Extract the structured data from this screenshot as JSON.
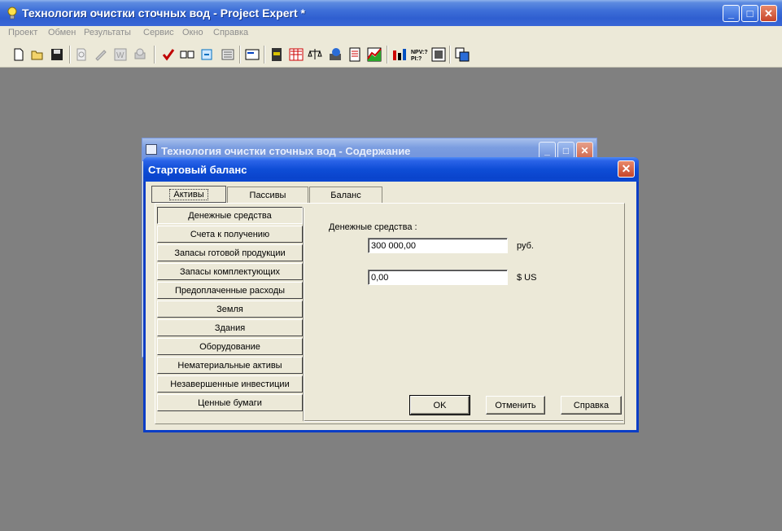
{
  "app": {
    "title": "Технология очистки сточных вод - Project Expert *",
    "minimize": "_",
    "maximize": "□",
    "close": "✕"
  },
  "menu": [
    "Проект",
    "Обмен",
    "Результаты",
    "Сервис",
    "Окно",
    "Справка"
  ],
  "toolbar_icons": [
    "new-icon",
    "open-icon",
    "save-icon",
    "preview-icon",
    "edit-icon",
    "word-icon",
    "print-icon",
    "check-icon",
    "compare-icon",
    "refresh-icon",
    "notes-icon",
    "text-icon",
    "table-icon",
    "cashflow-icon",
    "balance-icon",
    "finance-icon",
    "report-icon",
    "chart-icon",
    "bar-chart-icon",
    "npv-pi-icon",
    "analysis-icon",
    "export-icon"
  ],
  "child_window": {
    "title": "Технология очистки сточных вод - Содержание"
  },
  "dialog": {
    "title": "Стартовый баланс",
    "close": "✕",
    "tabs": [
      "Активы",
      "Пассивы",
      "Баланс"
    ],
    "side_items": [
      "Денежные средства",
      "Счета к получению",
      "Запасы готовой продукции",
      "Запасы комплектующих",
      "Предоплаченные расходы",
      "Земля",
      "Здания",
      "Оборудование",
      "Нематериальные активы",
      "Незавершенные инвестиции",
      "Ценные бумаги"
    ],
    "field_label": "Денежные средства :",
    "rub_value": "300 000,00",
    "rub_unit": "руб.",
    "usd_value": "0,00",
    "usd_unit": "$ US",
    "buttons": {
      "ok": "OK",
      "cancel": "Отменить",
      "help": "Справка"
    }
  }
}
